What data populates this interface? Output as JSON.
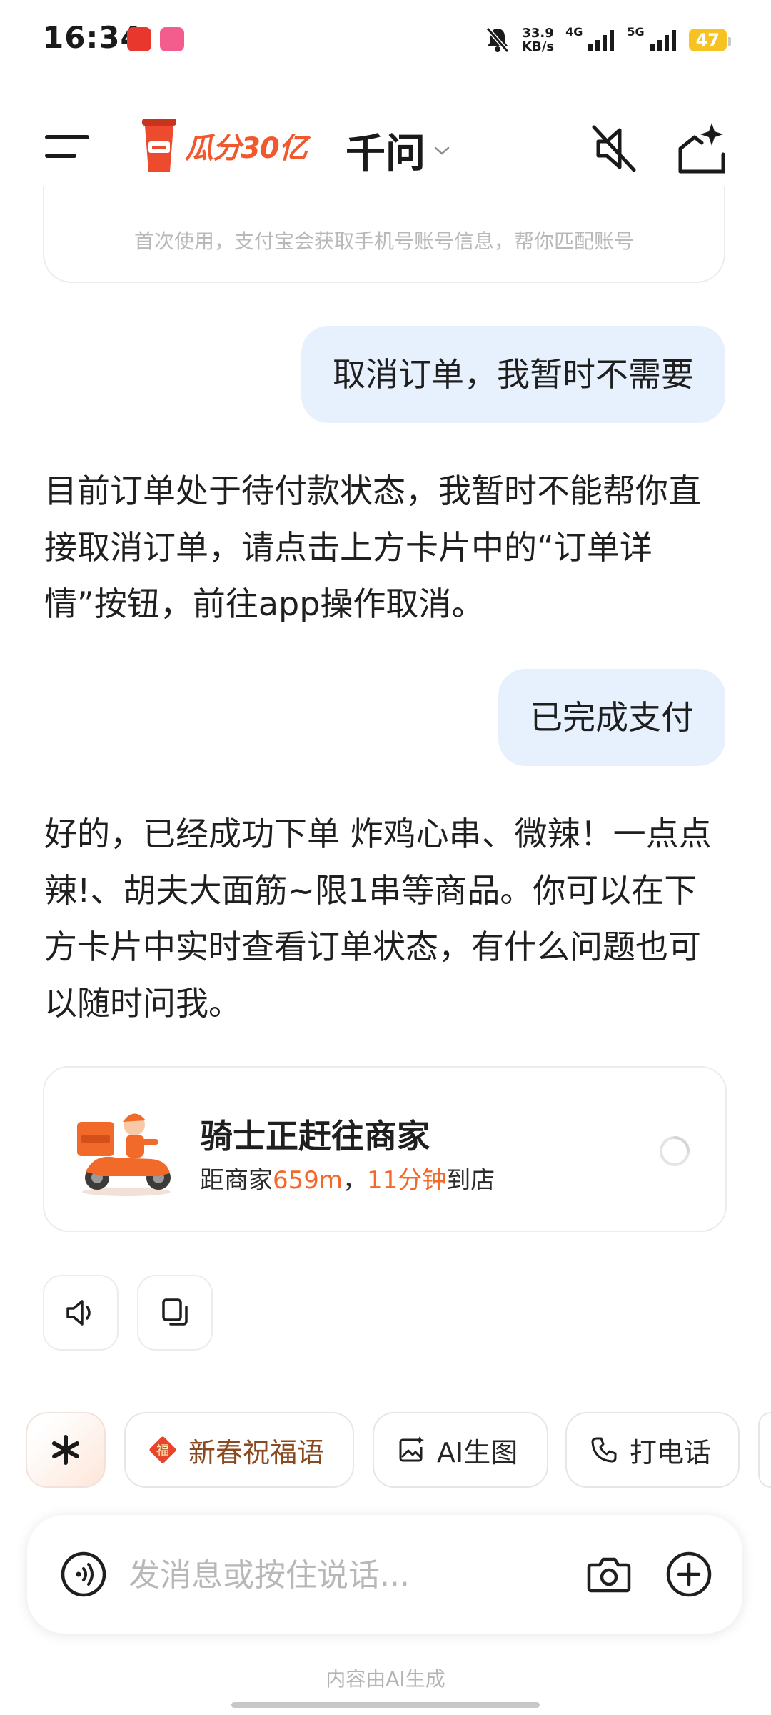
{
  "status_bar": {
    "time": "16:34",
    "net_speed_value": "33.9",
    "net_speed_unit": "KB/s",
    "signal_1_label": "4G",
    "signal_2_label": "5G",
    "battery": "47"
  },
  "nav": {
    "promo_text": "瓜分30亿",
    "title": "千问"
  },
  "chat": {
    "prev_card_text": "首次使用，支付宝会获取手机号账号信息，帮你匹配账号",
    "msg1_user": "取消订单，我暂时不需要",
    "msg2_ai": "目前订单处于待付款状态，我暂时不能帮你直接取消订单，请点击上方卡片中的“订单详情”按钮，前往app操作取消。",
    "msg3_user": "已完成支付",
    "msg4_ai": "好的，已经成功下单 炸鸡心串、微辣！一点点辣!、胡夫大面筋~限1串等商品。你可以在下方卡片中实时查看订单状态，有什么问题也可以随时问我。"
  },
  "order_card": {
    "title": "骑士正赶往商家",
    "dist_prefix": "距商家",
    "distance": "659m",
    "separator": "，",
    "eta": "11分钟",
    "eta_suffix": "到店"
  },
  "chips": {
    "spring_greetings": "新春祝福语",
    "ai_image": "AI生图",
    "call": "打电话"
  },
  "input": {
    "placeholder": "发消息或按住说话..."
  },
  "footer": {
    "disclaimer": "内容由AI生成"
  },
  "colors": {
    "accent_orange": "#f26a2a",
    "user_bubble": "#e7f1fd",
    "battery": "#f6c322"
  }
}
